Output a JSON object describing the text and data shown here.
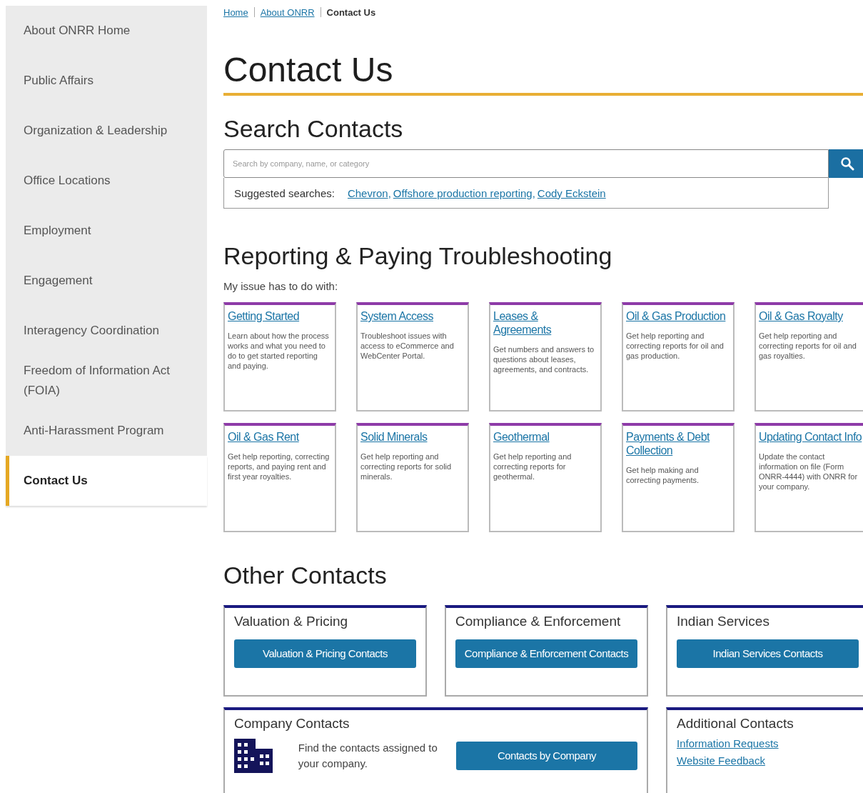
{
  "sidebar": {
    "items": [
      {
        "label": "About ONRR Home",
        "selected": false
      },
      {
        "label": "Public Affairs",
        "selected": false
      },
      {
        "label": "Organization & Leadership",
        "selected": false
      },
      {
        "label": "Office Locations",
        "selected": false
      },
      {
        "label": "Employment",
        "selected": false
      },
      {
        "label": "Engagement",
        "selected": false
      },
      {
        "label": "Interagency Coordination",
        "selected": false
      },
      {
        "label": "Freedom of Information Act (FOIA)",
        "selected": false
      },
      {
        "label": "Anti-Harassment Program",
        "selected": false
      },
      {
        "label": "Contact Us",
        "selected": true
      }
    ]
  },
  "breadcrumb": [
    {
      "label": "Home",
      "kind": "link"
    },
    {
      "label": "About ONRR",
      "kind": "link"
    },
    {
      "label": "Contact Us",
      "kind": "current"
    }
  ],
  "title": "Contact Us",
  "search": {
    "heading": "Search Contacts",
    "placeholder": "Search by company, name, or category",
    "suggested_label": "Suggested searches:",
    "suggestions": [
      "Chevron",
      "Offshore production reporting",
      "Cody Eckstein"
    ],
    "separator": ","
  },
  "troubleshooting": {
    "heading": "Reporting & Paying Troubleshooting",
    "intro": "My issue has to do with:",
    "cards": [
      {
        "title": "Getting Started",
        "description": "Learn about how the process works and what you need to do to get started reporting and paying."
      },
      {
        "title": "System Access",
        "description": "Troubleshoot issues with access to eCommerce and WebCenter Portal."
      },
      {
        "title": "Leases & Agreements",
        "description": "Get numbers and answers to questions about leases, agreements, and contracts."
      },
      {
        "title": "Oil & Gas Production",
        "description": "Get help reporting and correcting reports for oil and gas production."
      },
      {
        "title": "Oil & Gas Royalty",
        "description": "Get help reporting and correcting reports for oil and gas royalties."
      },
      {
        "title": "Oil & Gas Rent",
        "description": "Get help reporting, correcting reports, and paying rent and first year royalties."
      },
      {
        "title": "Solid Minerals",
        "description": "Get help reporting and correcting reports for solid minerals."
      },
      {
        "title": "Geothermal",
        "description": "Get help reporting and correcting reports for geothermal."
      },
      {
        "title": "Payments & Debt Collection",
        "description": "Get help making and correcting payments."
      },
      {
        "title": "Updating Contact Info",
        "description": "Update the contact information on file (Form ONRR-4444) with ONRR for your company."
      }
    ]
  },
  "other_contacts": {
    "heading": "Other Contacts",
    "cards": [
      {
        "kind": "button",
        "title": "Valuation & Pricing",
        "button": "Valuation & Pricing Contacts"
      },
      {
        "kind": "button",
        "title": "Compliance & Enforcement",
        "button": "Compliance & Enforcement Contacts"
      },
      {
        "kind": "button",
        "title": "Indian Services",
        "button": "Indian Services Contacts"
      },
      {
        "kind": "company",
        "title": "Company Contacts",
        "text": "Find the contacts assigned to your company.",
        "button": "Contacts by Company"
      },
      {
        "kind": "links",
        "title": "Additional Contacts",
        "links": [
          "Information Requests",
          "Website Feedback"
        ]
      }
    ]
  }
}
